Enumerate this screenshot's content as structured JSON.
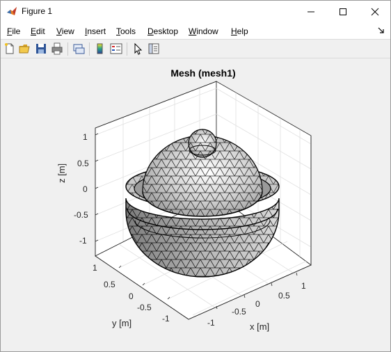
{
  "window": {
    "title": "Figure 1"
  },
  "menu": {
    "items": [
      {
        "label": "File",
        "underline": "F",
        "rest": "ile"
      },
      {
        "label": "Edit",
        "underline": "E",
        "rest": "dit"
      },
      {
        "label": "View",
        "underline": "V",
        "rest": "iew"
      },
      {
        "label": "Insert",
        "underline": "I",
        "rest": "nsert"
      },
      {
        "label": "Tools",
        "underline": "T",
        "rest": "ools"
      },
      {
        "label": "Desktop",
        "underline": "D",
        "rest": "esktop"
      },
      {
        "label": "Window",
        "underline": "W",
        "rest": "indow"
      },
      {
        "label": "Help",
        "underline": "H",
        "rest": "elp"
      }
    ]
  },
  "toolbar": {
    "icons": [
      "new-figure-icon",
      "open-file-icon",
      "save-icon",
      "print-icon",
      "link-plot-icon",
      "insert-colorbar-icon",
      "insert-legend-icon",
      "edit-plot-icon",
      "property-inspector-icon"
    ]
  },
  "plot": {
    "title": "Mesh (mesh1)",
    "xlabel": "x [m]",
    "ylabel": "y [m]",
    "zlabel": "z [m]",
    "x_ticks": [
      "-1",
      "-0.5",
      "0",
      "0.5",
      "1"
    ],
    "y_ticks": [
      "1",
      "0.5",
      "0",
      "-0.5",
      "-1"
    ],
    "z_ticks": [
      "1",
      "0.5",
      "0",
      "-0.5",
      "-1"
    ]
  },
  "colors": {
    "mesh_face": "#b8b8b8",
    "mesh_edge": "#000000",
    "axes_bg": "#ffffff",
    "figure_bg": "#f0f0f0"
  }
}
